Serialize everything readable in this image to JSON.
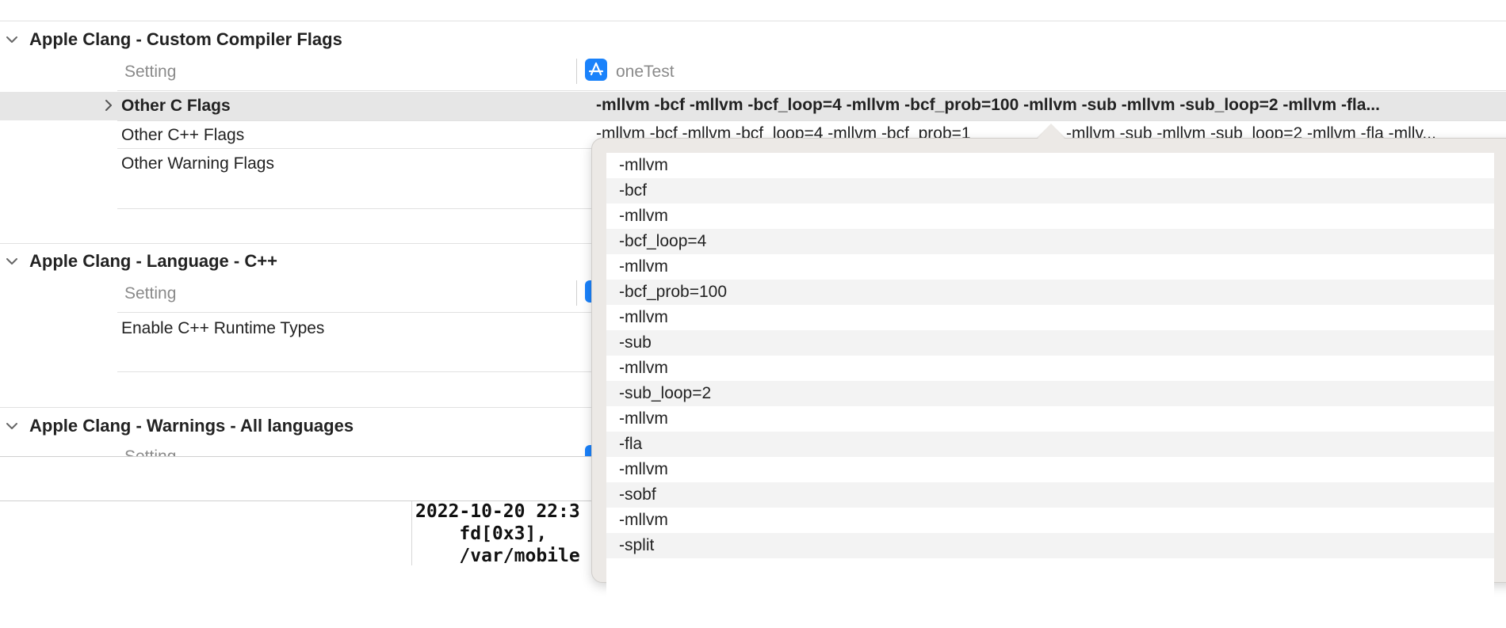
{
  "sections": [
    {
      "title": "Apple Clang - Custom Compiler Flags",
      "column_header": "Setting",
      "target_name": "oneTest",
      "rows": [
        {
          "name": "Other C Flags",
          "value": "-mllvm -bcf -mllvm -bcf_loop=4 -mllvm -bcf_prob=100 -mllvm -sub -mllvm -sub_loop=2 -mllvm -fla..."
        },
        {
          "name": "Other C++ Flags",
          "value": "-mllvm -bcf -mllvm -bcf_loop=4 -mllvm -bcf_prob=1"
        },
        {
          "name": "Other Warning Flags",
          "value": ""
        }
      ],
      "cpp_value_tail": "-mllvm -sub -mllvm -sub_loop=2 -mllvm -fla -mllv..."
    },
    {
      "title": "Apple Clang - Language - C++",
      "column_header": "Setting",
      "rows": [
        {
          "name": "Enable C++ Runtime Types",
          "value": ""
        }
      ]
    },
    {
      "title": "Apple Clang - Warnings - All languages",
      "column_header": "Setting"
    }
  ],
  "popover": {
    "flags": [
      "-mllvm",
      "-bcf",
      "-mllvm",
      "-bcf_loop=4",
      "-mllvm",
      "-bcf_prob=100",
      "-mllvm",
      "-sub",
      "-mllvm",
      "-sub_loop=2",
      "-mllvm",
      "-fla",
      "-mllvm",
      "-sobf",
      "-mllvm",
      "-split"
    ]
  },
  "console": {
    "line1": "2022-10-20 22:3",
    "line2": "    fd[0x3],",
    "line3": "    /var/mobile"
  },
  "colors": {
    "accent": "#1a82fb",
    "selected_row": "#e6e6e6",
    "popover_bg": "#ece9e6"
  },
  "icons": {
    "expand": "chevron-down-icon",
    "row_disclosure": "chevron-right-icon",
    "target": "app-store-icon"
  }
}
